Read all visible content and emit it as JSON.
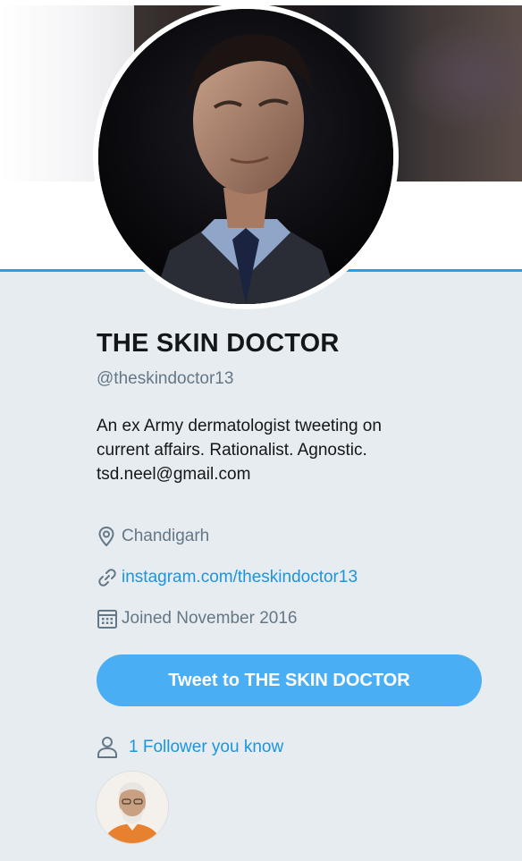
{
  "profile": {
    "name": "THE SKIN DOCTOR",
    "handle": "@theskindoctor13",
    "bio_lines": [
      "An ex Army dermatologist tweeting on",
      "current affairs. Rationalist. Agnostic.",
      "tsd.neel@gmail.com"
    ],
    "location": "Chandigarh",
    "url": "instagram.com/theskindoctor13",
    "joined": "Joined November 2016"
  },
  "actions": {
    "tweet_to_label": "Tweet to THE SKIN DOCTOR"
  },
  "followers_you_know": {
    "label": "1 Follower you know"
  },
  "icons": {
    "location": "map-pin-icon",
    "url": "link-icon",
    "joined": "calendar-icon",
    "followers": "person-icon"
  },
  "colors": {
    "accent": "#1da1f2",
    "button": "#4aaef5",
    "link": "#1b95e0",
    "muted_text": "#657786",
    "panel_bg": "#e6ecf0"
  }
}
